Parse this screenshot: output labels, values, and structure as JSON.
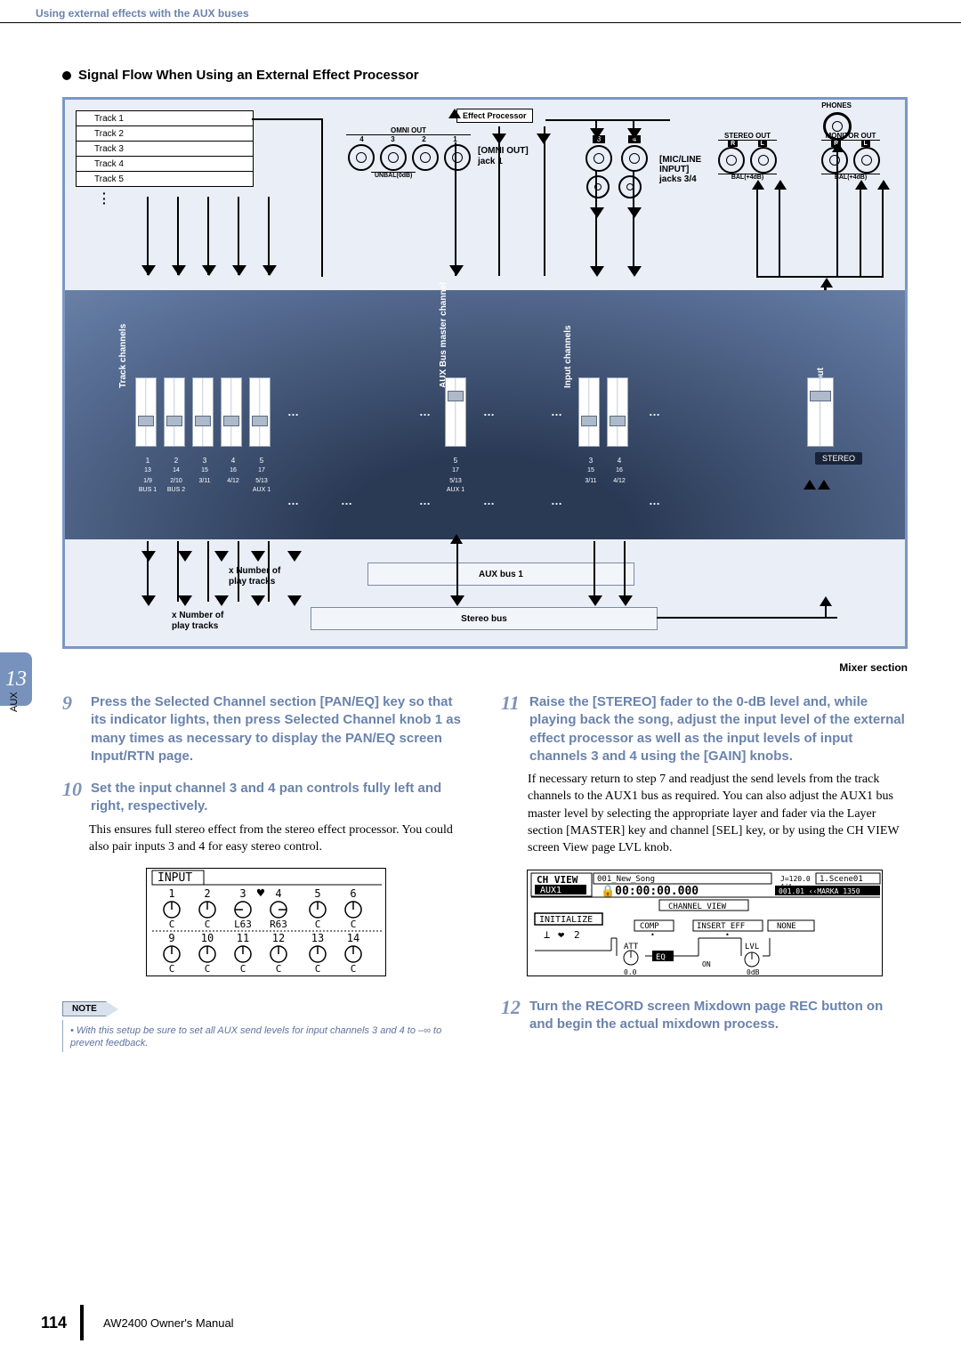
{
  "header": {
    "section_title": "Using external effects with the AUX buses"
  },
  "tab": {
    "number": "13",
    "label": "AUX"
  },
  "diagram": {
    "heading": "Signal Flow When Using an External Effect Processor",
    "tracks": [
      "Track 1",
      "Track 2",
      "Track 3",
      "Track 4",
      "Track 5"
    ],
    "effect_label": "Effect Processor",
    "omni_out_label": "OMNI OUT",
    "omni_nums": [
      "4",
      "3",
      "2",
      "1"
    ],
    "unbal": "UNBAL(0dB)",
    "outjack_label_1": "[OMNI OUT]",
    "outjack_label_2": "jack 1",
    "micline_1": "[MIC/LINE",
    "micline_2": "INPUT]",
    "micline_3": "jacks 3/4",
    "phones": "PHONES",
    "stereo_out": "STEREO OUT",
    "monitor_out": "MONITOR OUT",
    "rl": [
      "R",
      "L"
    ],
    "bal1": "BAL(+4dB)",
    "bal2": "BAL(+4dB)",
    "rot_track": "Track channels",
    "rot_aux": "AUX Bus master channel",
    "rot_input": "Input channels",
    "rot_stereo": "Stereo output channel",
    "fader_row1": [
      "1",
      "2",
      "3",
      "4",
      "5"
    ],
    "fader_row1_b": [
      "13",
      "14",
      "15",
      "16",
      "17"
    ],
    "fader_row1_c": [
      "1/9",
      "2/10",
      "3/11",
      "4/12",
      "5/13"
    ],
    "fader_row1_d": [
      "BUS 1",
      "BUS 2",
      "",
      "",
      "AUX 1"
    ],
    "mid_top": "5",
    "mid_b": "17",
    "mid_c": "5/13",
    "mid_d": "AUX 1",
    "in_top": [
      "3",
      "4"
    ],
    "in_b": [
      "15",
      "16"
    ],
    "in_c": [
      "3/11",
      "4/12"
    ],
    "stereo_cap": "STEREO",
    "aux_box": "AUX bus 1",
    "stereo_box": "Stereo bus",
    "play1_a": "x Number of",
    "play1_b": "play tracks",
    "play2_a": "x Number of",
    "play2_b": "play tracks",
    "mixer_caption": "Mixer section",
    "omni_box3": "3",
    "omni_box4": "4"
  },
  "steps": {
    "s9_n": "9",
    "s9": "Press the Selected Channel section [PAN/EQ] key so that its indicator lights, then press Selected Channel knob 1 as many times as necessary to display the PAN/EQ screen Input/RTN page.",
    "s10_n": "10",
    "s10": "Set the input channel 3 and 4 pan controls fully left and right, respectively.",
    "s10_body": "This ensures full stereo effect from the stereo effect processor. You could also pair inputs 3 and 4 for easy stereo control.",
    "s11_n": "11",
    "s11": "Raise the [STEREO] fader to the 0-dB level and, while playing back the song, adjust the input level of the external effect processor as well as the input levels of input channels 3 and 4 using the [GAIN] knobs.",
    "s11_body": "If necessary return to step 7 and readjust the send levels from the track channels to the AUX1 bus as required. You can also adjust the AUX1 bus master level by selecting the appropriate layer and fader via the Layer section [MASTER] key and channel [SEL] key, or by using the CH VIEW screen View page LVL knob.",
    "s12_n": "12",
    "s12": "Turn the RECORD screen Mixdown page REC button on and begin the actual mixdown process."
  },
  "input_panel": {
    "title": "INPUT",
    "row1": [
      "1",
      "2",
      "3",
      "4",
      "5",
      "6"
    ],
    "row1_vals": [
      "C",
      "C",
      "L63",
      "R63",
      "C",
      "C"
    ],
    "row2": [
      "9",
      "10",
      "11",
      "12",
      "13",
      "14"
    ],
    "row2_vals": [
      "C",
      "C",
      "C",
      "C",
      "C",
      "C"
    ]
  },
  "note": {
    "label": "NOTE",
    "bullet": "•",
    "text": "With this setup be sure to set all AUX send levels for input channels 3 and 4 to –∞ to prevent feedback."
  },
  "chview": {
    "title": "CH VIEW",
    "sub": "AUX1",
    "song": "001_New_Song",
    "time": "00:00:00.000",
    "tempo": "J=120.0  4/4",
    "scene": "1.Scene01",
    "marker": "001.01  ‹‹MARKA  1350",
    "views": "CHANNEL VIEW",
    "init": "INITIALIZE",
    "comp": "COMP",
    "insert": "INSERT EFF",
    "none": "NONE",
    "num2": "2",
    "att": "ATT",
    "eq": "EQ",
    "on": "ON",
    "lvl": "LVL",
    "db": "0.0 dB"
  },
  "footer": {
    "page": "114",
    "manual": "AW2400  Owner's Manual"
  }
}
